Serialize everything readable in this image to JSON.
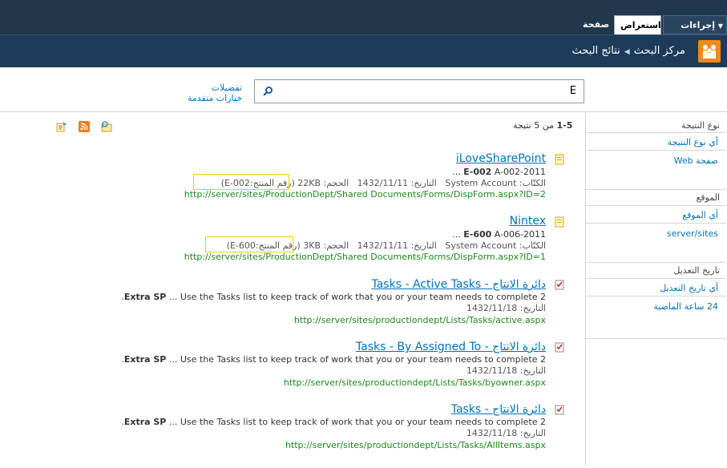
{
  "ribbon": {
    "site_actions": "إجراءات الموقع",
    "tab_browse": "استعراض",
    "tab_page": "صفحة"
  },
  "breadcrumb": {
    "site": "مركز البحث",
    "page": "نتائج البحث"
  },
  "search": {
    "query": "E",
    "preferences": "تفضيلات",
    "advanced": "خيارات متقدمة"
  },
  "results_info": {
    "range": "1-5",
    "of": "من 5 نتيجة"
  },
  "refinement": {
    "result_type_heading": "نوع النتيجة",
    "result_type_any": "أي نوع النتيجة",
    "result_type_item": "صفحة Web",
    "site_heading": "الموقع",
    "site_any": "أي الموقع",
    "site_item": "server/sites",
    "modified_heading": "تاريخ التعديل",
    "modified_any": "أي تاريخ التعديل",
    "modified_item": "24 ساعة الماضية"
  },
  "results": [
    {
      "title": "iLoveSharePoint",
      "summary_bold": "E-002",
      "summary": "A-002-2011 ...",
      "meta_authors_label": "الكتّاب:",
      "meta_authors": "System Account",
      "meta_date_label": "التاريخ:",
      "meta_date": "1432/11/11",
      "meta_size_label": "الحجم:",
      "meta_size": "22KB",
      "property": "(رقم المنتج:E-002)",
      "url": "http://server/sites/ProductionDept/Shared Documents/Forms/DispForm.aspx?ID=2"
    },
    {
      "title": "Nintex",
      "summary_bold": "E-600",
      "summary": "A-006-2011 ...",
      "meta_authors_label": "الكتّاب:",
      "meta_authors": "System Account",
      "meta_date_label": "التاريخ:",
      "meta_date": "1432/11/11",
      "meta_size_label": "الحجم:",
      "meta_size": "3KB",
      "property": "(رقم المنتج:E-600)",
      "url": "http://server/sites/ProductionDept/Shared Documents/Forms/DispForm.aspx?ID=1"
    },
    {
      "title": "دائرة الانتاج - Tasks - Active Tasks",
      "summary_bold": "Extra SP",
      "summary_pre": "2",
      "summary": "... Use the Tasks list to keep track of work that you or your team needs to complete.",
      "meta_date_label": "التاريخ:",
      "meta_date": "1432/11/18",
      "url": "http://server/sites/productiondept/Lists/Tasks/active.aspx"
    },
    {
      "title": "دائرة الانتاج - Tasks - By Assigned To",
      "summary_bold": "Extra SP",
      "summary_pre": "2",
      "summary": "... Use the Tasks list to keep track of work that you or your team needs to complete.",
      "meta_date_label": "التاريخ:",
      "meta_date": "1432/11/18",
      "url": "http://server/sites/productiondept/Lists/Tasks/byowner.aspx"
    },
    {
      "title": "دائرة الانتاج - Tasks",
      "summary_bold": "Extra SP",
      "summary_pre": "2",
      "summary": "... Use the Tasks list to keep track of work that you or your team needs to complete.",
      "meta_date_label": "التاريخ:",
      "meta_date": "1432/11/18",
      "url": "http://server/sites/productiondept/Lists/Tasks/AllItems.aspx"
    }
  ]
}
